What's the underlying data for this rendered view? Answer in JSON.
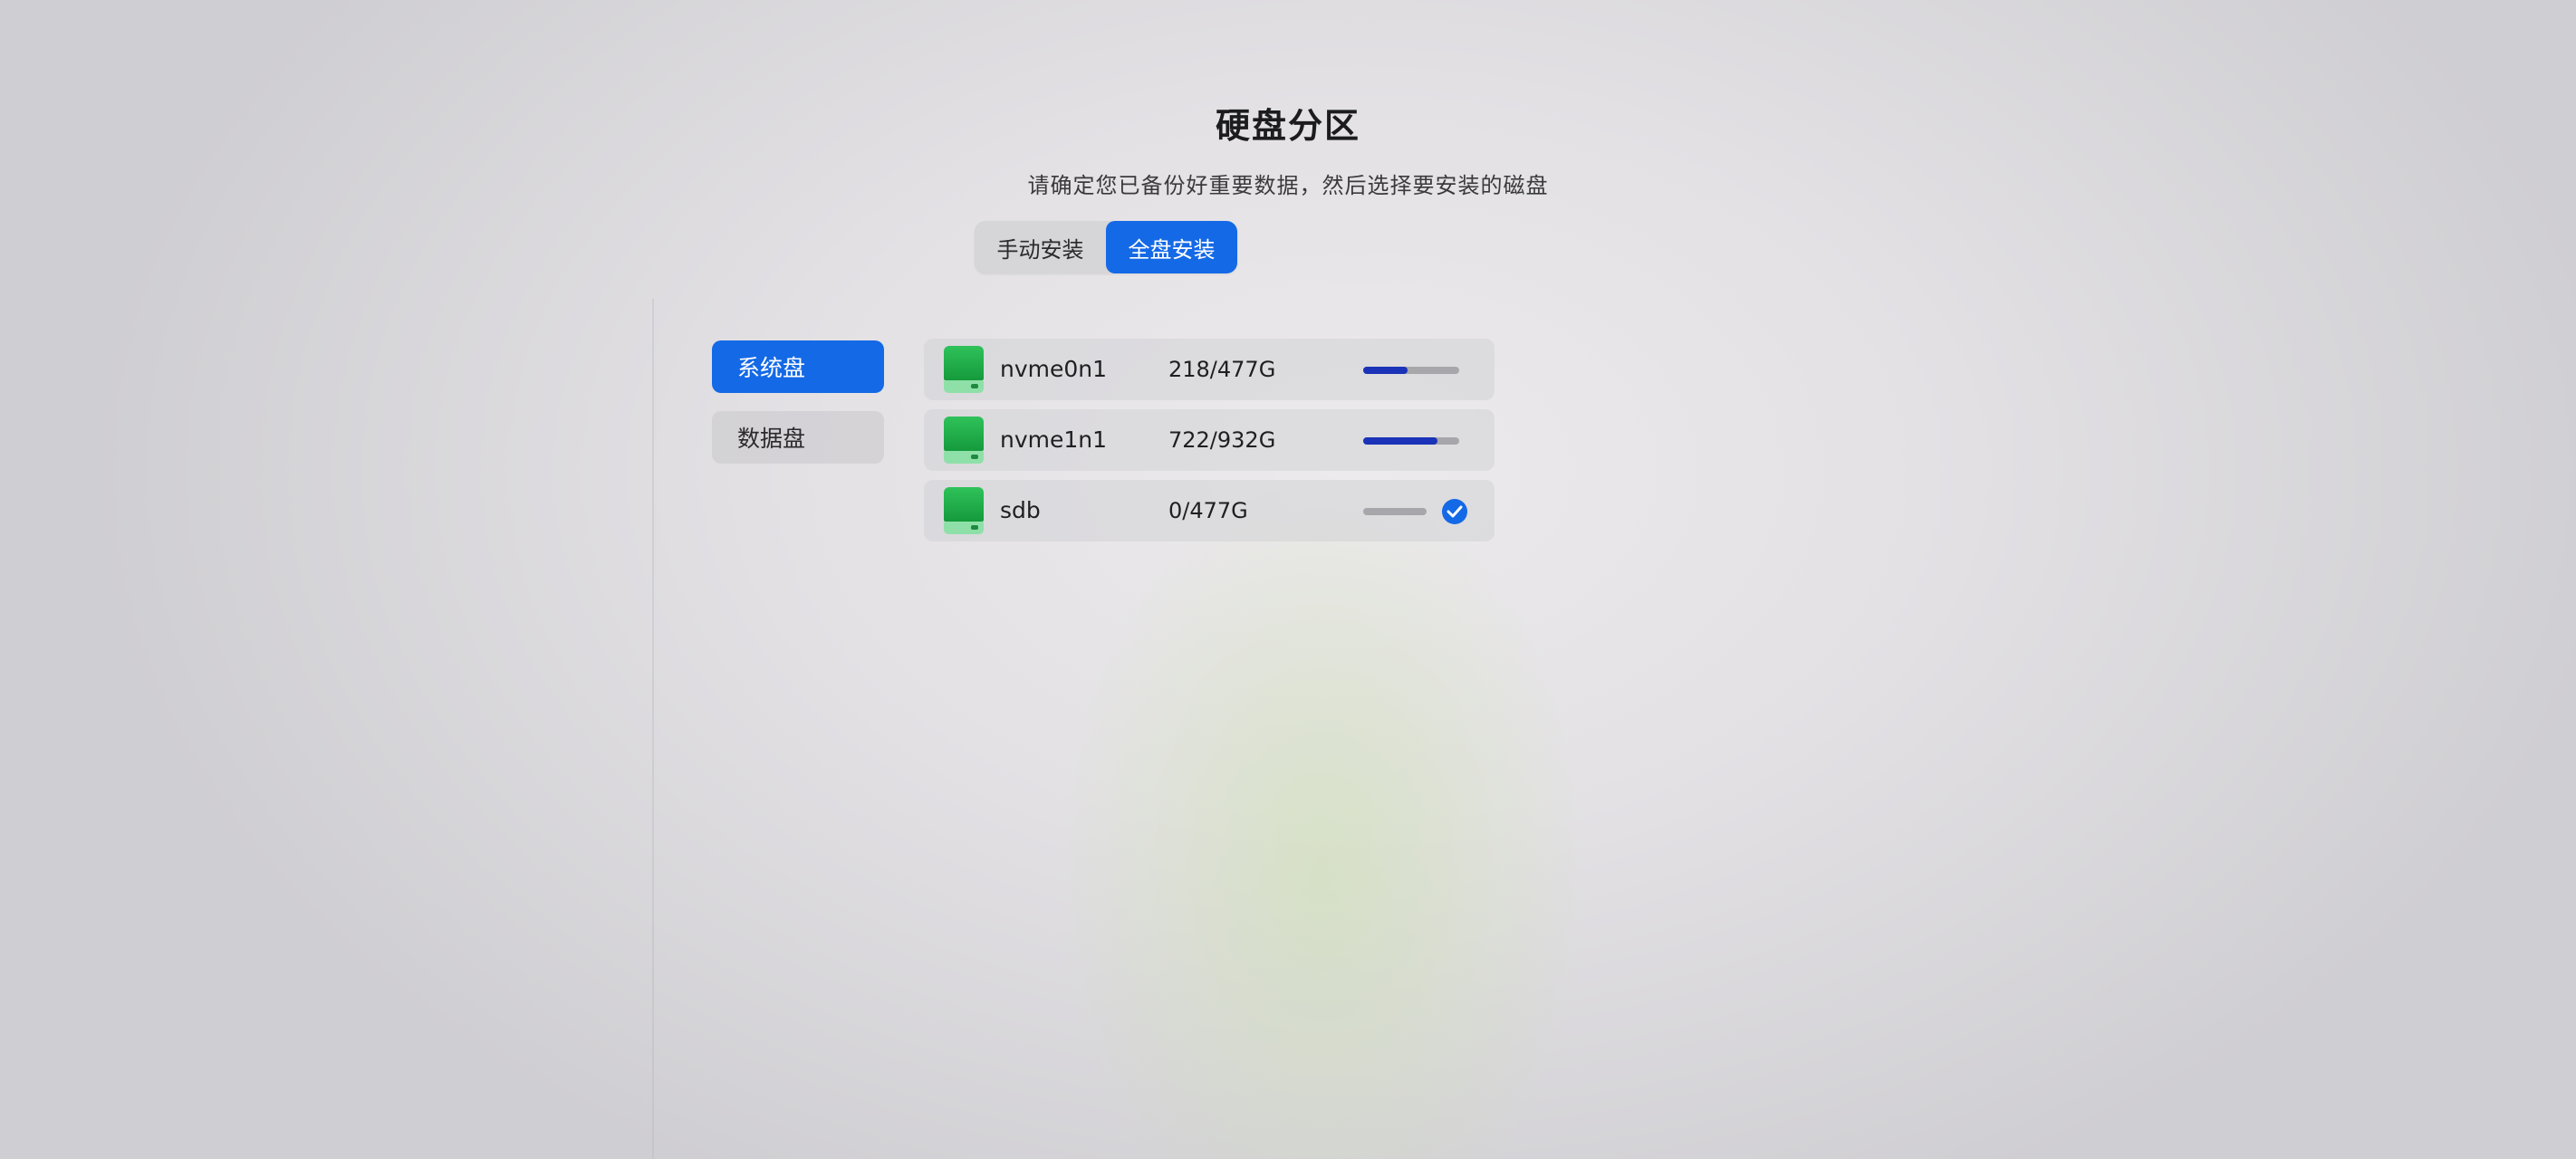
{
  "header": {
    "title": "硬盘分区",
    "subtitle": "请确定您已备份好重要数据，然后选择要安装的磁盘"
  },
  "mode_switch": {
    "manual_label": "手动安装",
    "full_label": "全盘安装",
    "selected": "全盘安装"
  },
  "sidebar": {
    "items": [
      {
        "label": "系统盘",
        "active": true
      },
      {
        "label": "数据盘",
        "active": false
      }
    ]
  },
  "disks": [
    {
      "name": "nvme0n1",
      "size": "218/477G",
      "usage_fraction": 0.46,
      "selected": false
    },
    {
      "name": "nvme1n1",
      "size": "722/932G",
      "usage_fraction": 0.77,
      "selected": false
    },
    {
      "name": "sdb",
      "size": "0/477G",
      "usage_fraction": 0.0,
      "selected": true
    }
  ],
  "colors": {
    "accent": "#1469e6",
    "usage_bar": "#1a33b8",
    "disk_icon": "#1ba846"
  },
  "icons": {
    "disk": "hard-disk-icon",
    "selected": "check-circle-icon"
  }
}
